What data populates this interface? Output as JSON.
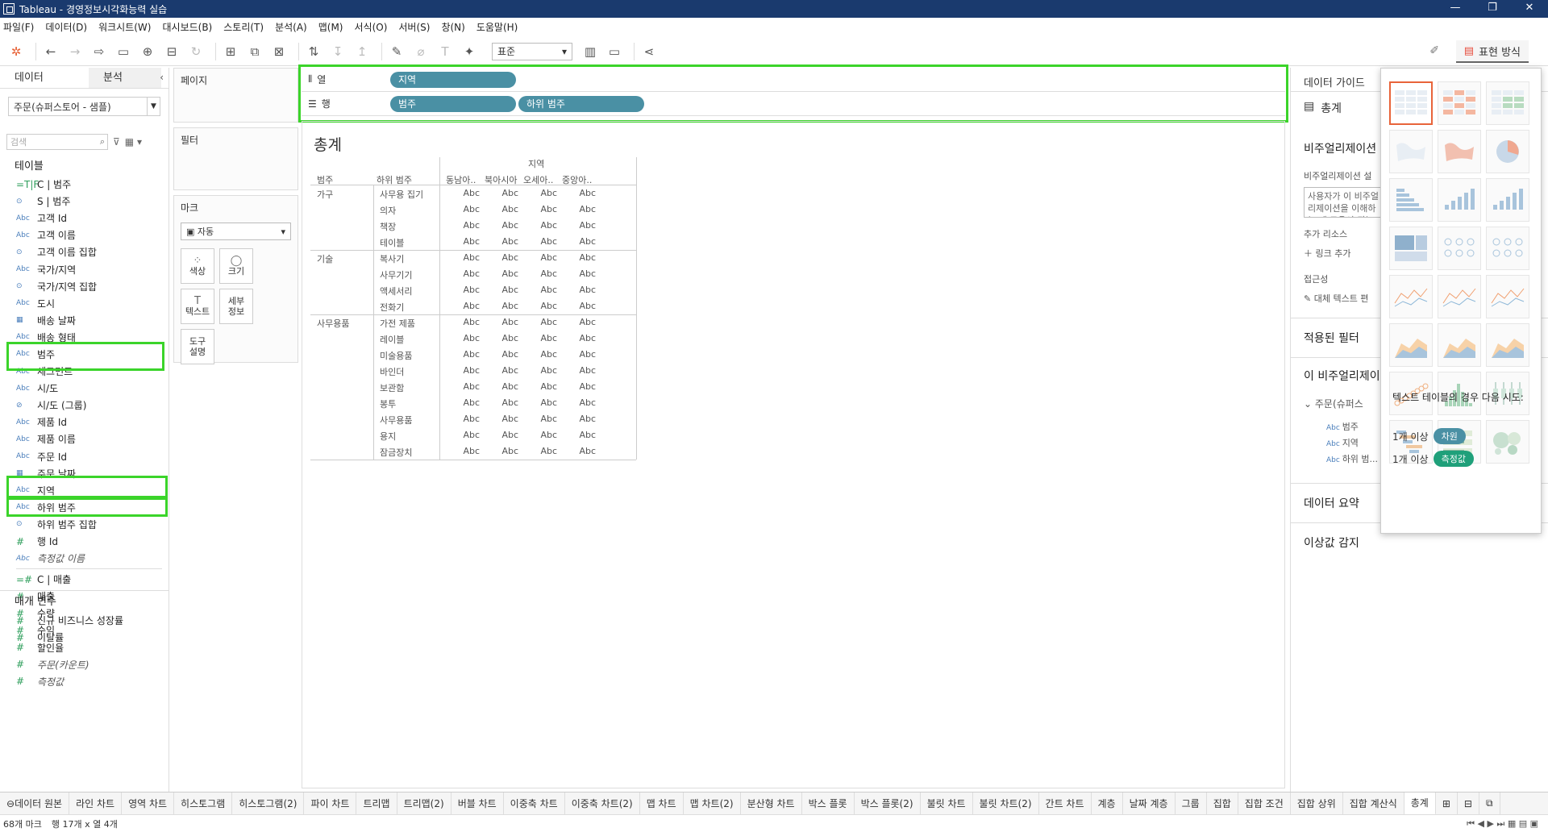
{
  "window": {
    "title": "Tableau - 경영정보시각화능력 실습",
    "min": "—",
    "max": "❐",
    "close": "✕"
  },
  "menu": [
    "파일(F)",
    "데이터(D)",
    "워크시트(W)",
    "대시보드(B)",
    "스토리(T)",
    "분석(A)",
    "맵(M)",
    "서식(O)",
    "서버(S)",
    "창(N)",
    "도움말(H)"
  ],
  "toolbar": {
    "fit": "표준",
    "showme": "표현 방식"
  },
  "datapane": {
    "tab_data": "데이터",
    "tab_analysis": "분석",
    "datasource": "주문(슈퍼스토어 - 샘플)",
    "search_placeholder": "검색",
    "tables_label": "테이블",
    "params_label": "매개 변수",
    "dims": [
      {
        "t": "=T|F",
        "name": "C | 범주",
        "c": "b"
      },
      {
        "t": "⊙",
        "name": "S | 범주",
        "c": "b"
      },
      {
        "t": "Abc",
        "name": "고객 Id"
      },
      {
        "t": "Abc",
        "name": "고객 이름"
      },
      {
        "t": "⊙",
        "name": "고객 이름 집합",
        "c": "b"
      },
      {
        "t": "Abc",
        "name": "국가/지역"
      },
      {
        "t": "⊙",
        "name": "국가/지역 집합",
        "c": "b"
      },
      {
        "t": "Abc",
        "name": "도시"
      },
      {
        "t": "▦",
        "name": "배송 날짜",
        "c": "b"
      },
      {
        "t": "Abc",
        "name": "배송 형태"
      },
      {
        "t": "Abc",
        "name": "범주"
      },
      {
        "t": "Abc",
        "name": "세그먼트"
      },
      {
        "t": "Abc",
        "name": "시/도"
      },
      {
        "t": "⊘",
        "name": "시/도 (그룹)",
        "c": "b"
      },
      {
        "t": "Abc",
        "name": "제품 Id"
      },
      {
        "t": "Abc",
        "name": "제품 이름"
      },
      {
        "t": "Abc",
        "name": "주문 Id"
      },
      {
        "t": "▦",
        "name": "주문 날짜",
        "c": "b"
      },
      {
        "t": "Abc",
        "name": "지역"
      },
      {
        "t": "Abc",
        "name": "하위 범주"
      },
      {
        "t": "⊙",
        "name": "하위 범주 집합",
        "c": "b"
      },
      {
        "t": "#",
        "name": "행 Id",
        "c": "g"
      },
      {
        "t": "Abc",
        "name": "측정값 이름",
        "it": true
      }
    ],
    "measures": [
      {
        "t": "=#",
        "name": "C | 매출"
      },
      {
        "t": "#",
        "name": "매출"
      },
      {
        "t": "#",
        "name": "수량"
      },
      {
        "t": "#",
        "name": "수익"
      },
      {
        "t": "#",
        "name": "할인율"
      },
      {
        "t": "#",
        "name": "주문(카운트)",
        "it": true
      },
      {
        "t": "#",
        "name": "측정값",
        "it": true
      }
    ],
    "params": [
      {
        "t": "#",
        "name": "신규 비즈니스 성장률"
      },
      {
        "t": "#",
        "name": "이탈률"
      }
    ]
  },
  "shelves": {
    "pages": "페이지",
    "filters": "필터",
    "marks": "마크",
    "marks_type": "자동",
    "mark_btns": [
      {
        "icon": "⁘",
        "label": "색상"
      },
      {
        "icon": "◯",
        "label": "크기"
      },
      {
        "icon": "T",
        "label": "텍스트"
      },
      {
        "icon": "",
        "label": "세부\n정보"
      },
      {
        "icon": "",
        "label": "도구\n설명"
      }
    ],
    "columns_label": "열",
    "rows_label": "행",
    "columns": [
      "지역"
    ],
    "rows": [
      "범주",
      "하위 범주"
    ]
  },
  "view": {
    "title": "총계",
    "col_header": "지역",
    "row_h1": "범주",
    "row_h2": "하위 범주",
    "regions": [
      "동남아..",
      "북아시아",
      "오세아..",
      "중앙아.."
    ],
    "groups": [
      {
        "cat": "가구",
        "subs": [
          "사무용 집기",
          "의자",
          "책장",
          "테이블"
        ]
      },
      {
        "cat": "기술",
        "subs": [
          "복사기",
          "사무기기",
          "액세서리",
          "전화기"
        ]
      },
      {
        "cat": "사무용품",
        "subs": [
          "가전 제품",
          "레이블",
          "미술용품",
          "바인더",
          "보관함",
          "봉투",
          "사무용품",
          "용지",
          "잠금장치"
        ]
      }
    ],
    "cell": "Abc"
  },
  "rightpane": {
    "header": "데이터 가이드",
    "sheet": "총계",
    "viz_desc": "비주얼리제이션",
    "viz_desc2": "비주얼리제이션 설",
    "box_text": "사용자가 이 비주얼리제이션을 이해하는 데 도움이 되는 설명을 입",
    "more": "추가 리소스",
    "add_link": "링크 추가",
    "access": "접근성",
    "alt_text": "대체 텍스트 편",
    "filters": "적용된 필터",
    "data_in": "이 비주얼리제이",
    "source": "주문(슈퍼스",
    "fields": [
      "범주",
      "지역",
      "하위 범..."
    ],
    "summary": "데이터 요약",
    "outlier": "이상값 감지"
  },
  "showme": {
    "hint": "텍스트 테이블의 경우 다음 시도:",
    "req1": "1개 이상",
    "tag1": "차원",
    "req2": "1개 이상",
    "tag2": "측정값",
    "tag1_color": "#4a90a4",
    "tag2_color": "#1fa07a"
  },
  "sheets": [
    "데이터 원본",
    "라인 차트",
    "영역 차트",
    "히스토그램",
    "히스토그램(2)",
    "파이 차트",
    "트리맵",
    "트리맵(2)",
    "버블 차트",
    "이중축 차트",
    "이중축 차트(2)",
    "맵 차트",
    "맵 차트(2)",
    "분산형 차트",
    "박스 플롯",
    "박스 플롯(2)",
    "불릿 차트",
    "불릿 차트(2)",
    "간트 차트",
    "계층",
    "날짜 계층",
    "그룹",
    "집합",
    "집합 조건",
    "집합 상위",
    "집합 계산식",
    "총계"
  ],
  "status": {
    "marks": "68개 마크",
    "dims": "행 17개 x 열 4개"
  }
}
